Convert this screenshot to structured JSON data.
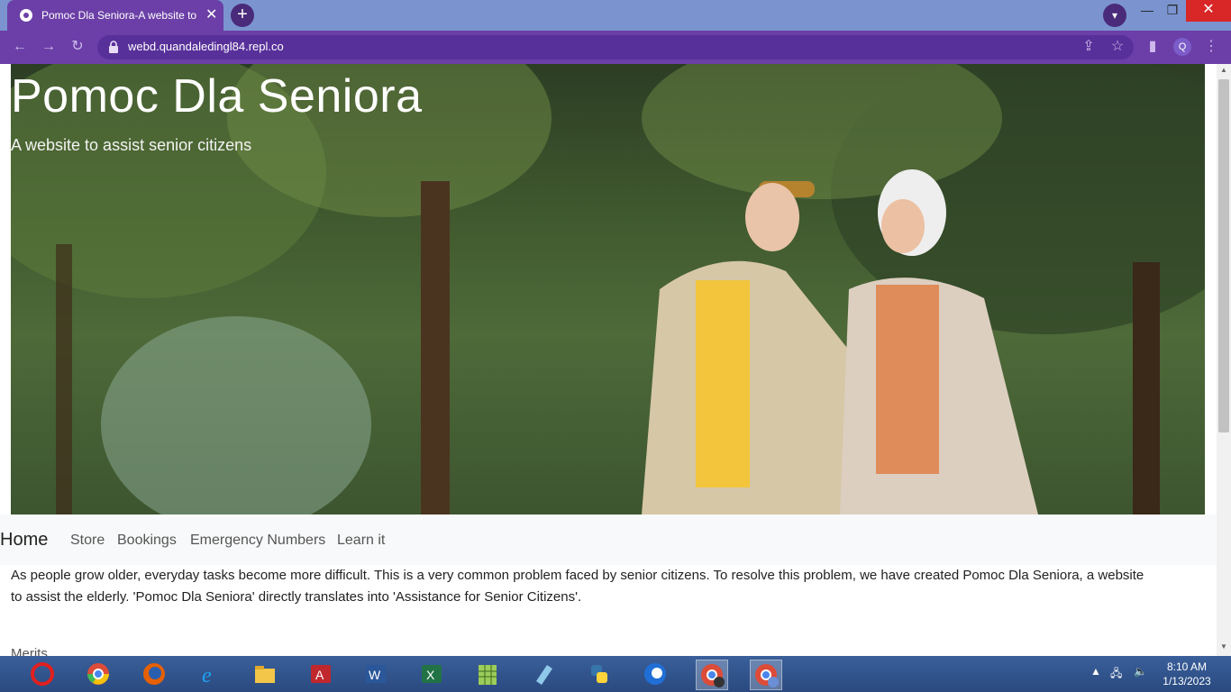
{
  "browser": {
    "tab_title": "Pomoc Dla Seniora-A website to",
    "url": "webd.quandaledingl84.repl.co",
    "profile_initial": "Q"
  },
  "page": {
    "hero_title": "Pomoc Dla Seniora",
    "hero_subtitle": "A website to assist senior citizens",
    "nav": {
      "brand": "Home",
      "links": [
        "Store",
        "Bookings",
        "Emergency Numbers",
        "Learn it"
      ]
    },
    "intro_line1": "As people grow older, everyday tasks become more difficult. This is a very common problem faced by senior citizens. To resolve this problem, we have created Pomoc Dla Seniora, a website",
    "intro_line2": "to assist the elderly. 'Pomoc Dla Seniora' directly translates into 'Assistance for Senior Citizens'.",
    "merits_heading": "Merits"
  },
  "taskbar": {
    "time": "8:10 AM",
    "date": "1/13/2023"
  }
}
